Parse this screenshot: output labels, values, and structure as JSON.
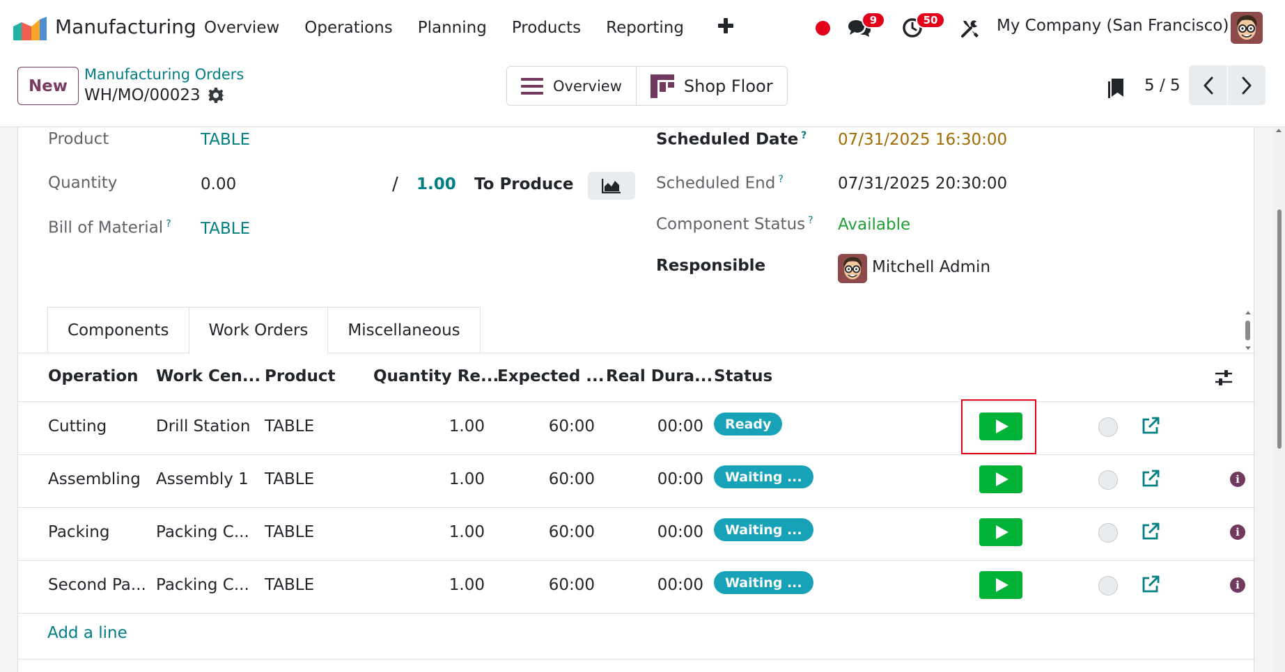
{
  "navbar": {
    "app_name": "Manufacturing",
    "menu": [
      "Overview",
      "Operations",
      "Planning",
      "Products",
      "Reporting"
    ],
    "messages_count": "9",
    "activities_count": "50",
    "company": "My Company (San Francisco)",
    "icons": [
      "app-logo",
      "plus-icon",
      "record-dot",
      "chat-icon",
      "clock-icon",
      "tools-icon",
      "user-avatar"
    ]
  },
  "control": {
    "new_label": "New",
    "breadcrumb": "Manufacturing Orders",
    "record": "WH/MO/00023",
    "views": {
      "overview": "Overview",
      "shop_floor": "Shop Floor"
    },
    "pager": "5 / 5"
  },
  "form": {
    "product_label": "Product",
    "product_value": "TABLE",
    "quantity_label": "Quantity",
    "quantity_value": "0.00",
    "quantity_separator": "/",
    "quantity_target": "1.00",
    "to_produce": "To Produce",
    "bom_label": "Bill of Material",
    "bom_value": "TABLE",
    "help_mark": "?",
    "scheduled_date_label": "Scheduled Date",
    "scheduled_date_value": "07/31/2025 16:30:00",
    "scheduled_end_label": "Scheduled End",
    "scheduled_end_value": "07/31/2025 20:30:00",
    "component_status_label": "Component Status",
    "component_status_value": "Available",
    "responsible_label": "Responsible",
    "responsible_value": "Mitchell Admin"
  },
  "tabs": [
    {
      "label": "Components",
      "active": false
    },
    {
      "label": "Work Orders",
      "active": true
    },
    {
      "label": "Miscellaneous",
      "active": false
    }
  ],
  "table": {
    "headers": [
      "Operation",
      "Work Cen...",
      "Product",
      "Quantity Re...",
      "Expected ...",
      "Real Dura...",
      "Status"
    ],
    "rows": [
      {
        "operation": "Cutting",
        "work_center": "Drill Station",
        "product": "TABLE",
        "quantity": "1.00",
        "expected": "60:00",
        "real": "00:00",
        "status": "Ready"
      },
      {
        "operation": "Assembling",
        "work_center": "Assembly 1",
        "product": "TABLE",
        "quantity": "1.00",
        "expected": "60:00",
        "real": "00:00",
        "status": "Waiting ..."
      },
      {
        "operation": "Packing",
        "work_center": "Packing C...",
        "product": "TABLE",
        "quantity": "1.00",
        "expected": "60:00",
        "real": "00:00",
        "status": "Waiting ..."
      },
      {
        "operation": "Second Pa...",
        "work_center": "Packing C...",
        "product": "TABLE",
        "quantity": "1.00",
        "expected": "60:00",
        "real": "00:00",
        "status": "Waiting ..."
      }
    ],
    "add_line": "Add a line",
    "info_glyph": "i"
  },
  "colors": {
    "accent": "#017e84",
    "brand": "#71395d",
    "play": "#00b336",
    "status_badge": "#17a2b8",
    "highlight": "#e3001b"
  }
}
